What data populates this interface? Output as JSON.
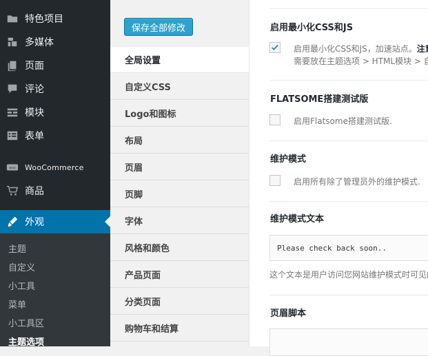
{
  "sidebar": {
    "items": [
      {
        "label": "特色项目",
        "icon": "folder-icon"
      },
      {
        "label": "多媒体",
        "icon": "media-icon"
      },
      {
        "label": "页面",
        "icon": "page-icon"
      },
      {
        "label": "评论",
        "icon": "comment-icon"
      },
      {
        "label": "模块",
        "icon": "blocks-icon"
      },
      {
        "label": "表单",
        "icon": "form-icon"
      },
      {
        "label": "WooCommerce",
        "icon": "woocommerce-icon"
      },
      {
        "label": "商品",
        "icon": "cart-icon"
      },
      {
        "label": "外观",
        "icon": "brush-icon"
      }
    ],
    "submenu": [
      "主题",
      "自定义",
      "小工具",
      "菜单",
      "小工具区",
      "主题选项"
    ],
    "accent_color": "#0073aa"
  },
  "panel": {
    "save_label": "保存全部修改",
    "tabs": [
      "全局设置",
      "自定义CSS",
      "Logo和图标",
      "布局",
      "页眉",
      "页脚",
      "字体",
      "风格和颜色",
      "产品页面",
      "分类页面",
      "购物车和结算"
    ]
  },
  "main": {
    "minify": {
      "title": "启用最小化CSS和JS",
      "label_line1": "启用最小化CSS和JS，加速站点。",
      "label_bold": "注意",
      "label_line2": "需要放在主题选项 > HTML模块 > 自定",
      "checked": true
    },
    "beta": {
      "title": "FLATSOME搭建测试版",
      "label": "启用Flatsome搭建测试版."
    },
    "maintenance": {
      "title": "维护模式",
      "label": "启用所有除了管理员外的维护模式."
    },
    "maintenance_text": {
      "title": "维护模式文本",
      "value": "Please check back soon..",
      "help": "这个文本是用户访问您网站维护模式时可见的"
    },
    "header_script": {
      "title": "页眉脚本"
    }
  }
}
